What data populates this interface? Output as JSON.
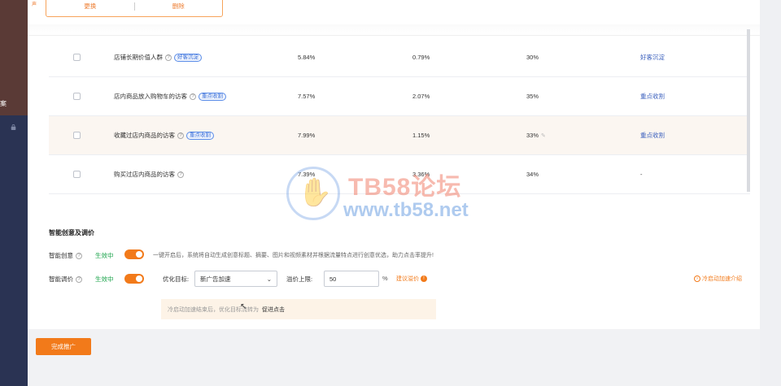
{
  "sidebar": {
    "label": "案"
  },
  "top": {
    "tiny": "声",
    "replace": "更换",
    "delete": "删除"
  },
  "rows": [
    {
      "name": "店铺长期价值人群",
      "tag": "好客沉淀",
      "c1": "5.84%",
      "c2": "0.79%",
      "c3": "30%",
      "action": "好客沉淀"
    },
    {
      "name": "店内商品放入购物车的访客",
      "tag": "重点收割",
      "c1": "7.57%",
      "c2": "2.07%",
      "c3": "35%",
      "action": "重点收割"
    },
    {
      "name": "收藏过店内商品的访客",
      "tag": "重点收割",
      "c1": "7.99%",
      "c2": "1.15%",
      "c3": "33%",
      "action": "重点收割"
    },
    {
      "name": "购买过店内商品的访客",
      "tag": "",
      "c1": "7.39%",
      "c2": "3.36%",
      "c3": "34%",
      "action": "-"
    }
  ],
  "settings": {
    "title": "智能创意及调价",
    "creative_label": "智能创意",
    "creative_status": "生效中",
    "creative_desc": "一键开启后，系统将自动生成创意标题、摘要、图片和视频素材并根据流量特点进行创意优选，助力点击率提升!",
    "price_label": "智能调价",
    "price_status": "生效中",
    "target_label": "优化目标:",
    "target_value": "新广告加速",
    "cap_label": "溢价上限:",
    "cap_value": "50",
    "cap_unit": "%",
    "suggest": "建议溢价",
    "intro": "冷启动加速介绍",
    "notice_prefix": "冷启动加速结束后，优化目标流转为",
    "notice_target": "促进点击"
  },
  "finish_button": "完成推广",
  "watermark": {
    "line1": "TB58论坛",
    "line2": "www.tb58.net"
  },
  "colors": {
    "accent": "#f27a1a",
    "active": "#1aa34a",
    "link": "#3a5fbd"
  }
}
